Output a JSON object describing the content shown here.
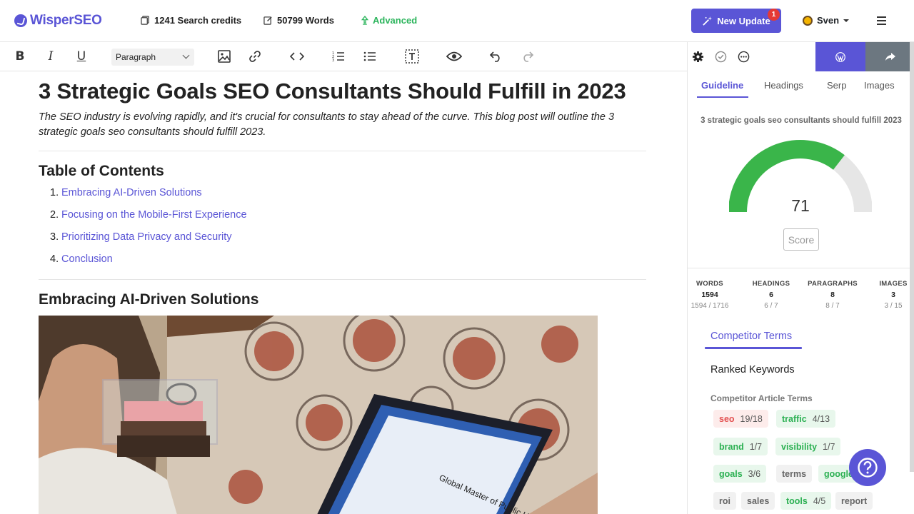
{
  "app": {
    "brand": "WisperSEO",
    "search_credits": "1241 Search credits",
    "words_count": "50799 Words",
    "plan": "Advanced",
    "update_button": "New Update",
    "update_badge": "1",
    "user_name": "Sven"
  },
  "toolbar": {
    "bold": "B",
    "italic": "I",
    "underline": "U",
    "block_format": "Paragraph"
  },
  "article": {
    "title": "3 Strategic Goals SEO Consultants Should Fulfill in 2023",
    "intro": "The SEO industry is evolving rapidly, and it's crucial for consultants to stay ahead of the curve. This blog post will outline the 3 strategic goals seo consultants should fulfill 2023.",
    "toc_heading": "Table of Contents",
    "toc": [
      {
        "num": "1.",
        "label": "Embracing AI-Driven Solutions"
      },
      {
        "num": "2.",
        "label": "Focusing on the Mobile-First Experience"
      },
      {
        "num": "3.",
        "label": "Prioritizing Data Privacy and Security"
      },
      {
        "num": "4.",
        "label": "Conclusion"
      }
    ],
    "section1_heading": "Embracing AI-Driven Solutions",
    "photo_caption": "Global Master of Public Health"
  },
  "panel": {
    "tabs": [
      "Guideline",
      "Headings",
      "Serp",
      "Images"
    ],
    "active_tab": "Guideline",
    "keyword": "3 strategic goals seo consultants should fulfill 2023",
    "score": "71",
    "score_fraction": 0.71,
    "score_button": "Score",
    "metrics": [
      {
        "label": "WORDS",
        "value": "1594",
        "sub": "1594 / 1716"
      },
      {
        "label": "HEADINGS",
        "value": "6",
        "sub": "6 / 7"
      },
      {
        "label": "PARAGRAPHS",
        "value": "8",
        "sub": "8 / 7"
      },
      {
        "label": "IMAGES",
        "value": "3",
        "sub": "3 / 15"
      }
    ],
    "competitor_tab": "Competitor Terms",
    "ranked_keywords": "Ranked Keywords",
    "article_terms_heading": "Competitor Article Terms",
    "terms": [
      {
        "term": "seo",
        "count": "19/18",
        "status": "red"
      },
      {
        "term": "traffic",
        "count": "4/13",
        "status": "green"
      },
      {
        "term": "brand",
        "count": "1/7",
        "status": "green"
      },
      {
        "term": "visibility",
        "count": "1/7",
        "status": "green"
      },
      {
        "term": "goals",
        "count": "3/6",
        "status": "green"
      },
      {
        "term": "terms",
        "count": "",
        "status": "gray"
      },
      {
        "term": "google",
        "count": "",
        "status": "green"
      },
      {
        "term": "roi",
        "count": "",
        "status": "gray"
      },
      {
        "term": "sales",
        "count": "",
        "status": "gray"
      },
      {
        "term": "tools",
        "count": "4/5",
        "status": "green"
      },
      {
        "term": "report",
        "count": "",
        "status": "gray"
      }
    ],
    "help_icon": "question-icon"
  },
  "colors": {
    "accent": "#5a55d6",
    "green": "#2db55d",
    "gauge_track": "#e6e6e6",
    "gauge_fill": "#3ab54a"
  }
}
